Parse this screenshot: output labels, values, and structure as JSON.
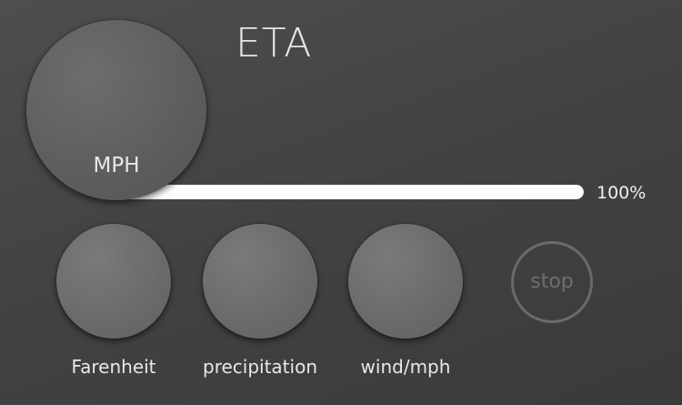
{
  "header": {
    "title": "ETA"
  },
  "speed_dial": {
    "label": "MPH"
  },
  "progress": {
    "value_percent": 100,
    "label": "100%"
  },
  "knobs": [
    {
      "label": "Farenheit"
    },
    {
      "label": "precipitation"
    },
    {
      "label": "wind/mph"
    }
  ],
  "stop": {
    "label": "stop"
  },
  "colors": {
    "background": "#444444",
    "dial": "#5e5e5e",
    "knob": "#6b6b6b",
    "progress_fill": "#ffffff",
    "text": "#e8e8e8",
    "stop_outline": "#6a6a6a"
  }
}
